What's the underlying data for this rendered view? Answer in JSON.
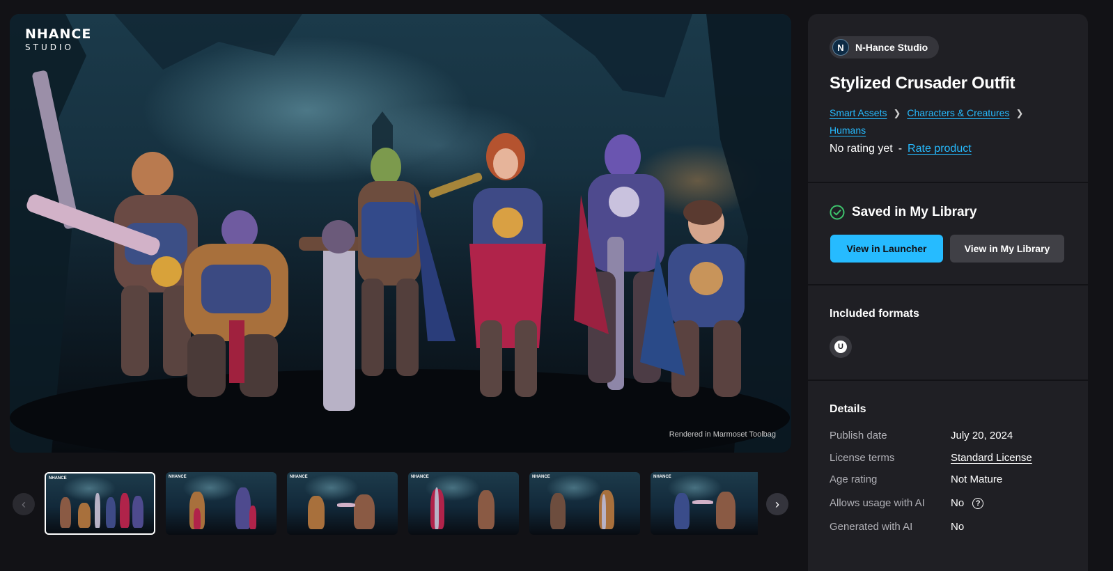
{
  "hero": {
    "logo_line1": "NHANCE",
    "logo_line2": "STUDIO",
    "render_note": "Rendered in Marmoset Toolbag"
  },
  "thumbnails": {
    "count": 6,
    "active_index": 0,
    "thumb_logo": "NHANCE"
  },
  "carousel": {
    "prev_icon": "chevron-left-icon",
    "next_icon": "chevron-right-icon"
  },
  "product": {
    "seller": {
      "avatar_letter": "N",
      "name": "N-Hance Studio"
    },
    "title": "Stylized Crusader Outfit",
    "breadcrumbs": [
      "Smart Assets",
      "Characters & Creatures",
      "Humans"
    ],
    "rating": {
      "text": "No rating yet",
      "separator": "-",
      "rate_link": "Rate product"
    }
  },
  "library": {
    "status": "Saved in My Library",
    "check_icon": "check-circle-icon",
    "launcher_button": "View in Launcher",
    "library_button": "View in My Library"
  },
  "formats": {
    "title": "Included formats",
    "items": [
      {
        "icon": "unreal-engine-icon",
        "glyph": "U"
      }
    ]
  },
  "details": {
    "title": "Details",
    "rows": [
      {
        "label": "Publish date",
        "value": "July 20, 2024"
      },
      {
        "label": "License terms",
        "value": "Standard License"
      },
      {
        "label": "Age rating",
        "value": "Not Mature"
      },
      {
        "label": "Allows usage with AI",
        "value": "No"
      },
      {
        "label": "Generated with AI",
        "value": "No"
      }
    ],
    "help_glyph": "?"
  },
  "colors": {
    "accent": "#26bbff",
    "page_bg": "#121216",
    "panel_bg": "#1f1f24",
    "success": "#3ec46d"
  }
}
